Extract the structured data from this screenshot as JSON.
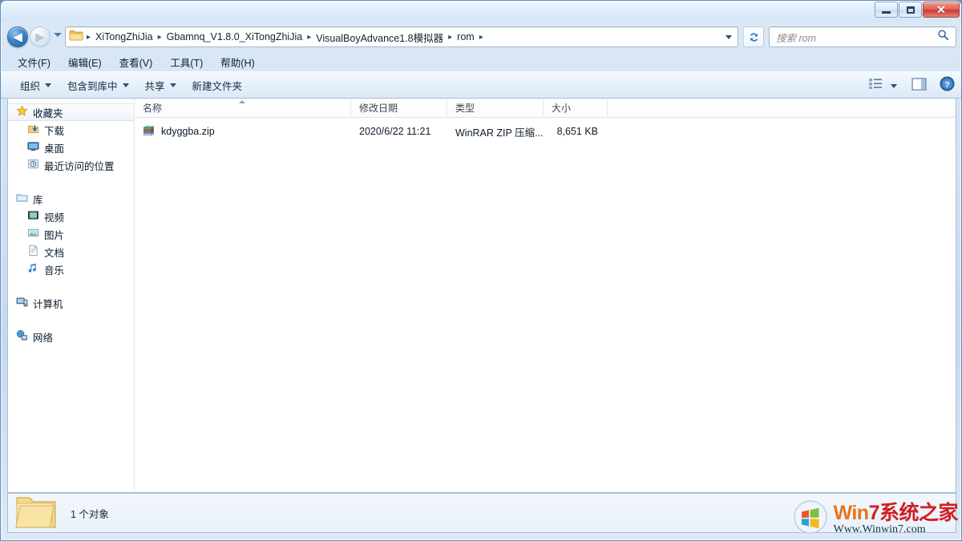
{
  "window": {
    "title": "",
    "buttons": {
      "minimize": "minimize",
      "maximize": "maximize",
      "close": "✕"
    }
  },
  "navigation": {
    "back_label": "◀",
    "forward_label": "▶",
    "history_dropdown": "history-dropdown",
    "refresh_label": "refresh"
  },
  "address": {
    "folder_icon": "folder-icon",
    "crumbs": [
      "XiTongZhiJia",
      "Gbamnq_V1.8.0_XiTongZhiJia",
      "VisualBoyAdvance1.8模拟器",
      "rom"
    ],
    "separator": "▸",
    "dropdown": "address-dropdown"
  },
  "search": {
    "placeholder": "搜索 rom",
    "icon": "search-icon"
  },
  "menubar": {
    "items": [
      {
        "label": "文件(F)"
      },
      {
        "label": "编辑(E)"
      },
      {
        "label": "查看(V)"
      },
      {
        "label": "工具(T)"
      },
      {
        "label": "帮助(H)"
      }
    ]
  },
  "commandbar": {
    "items": [
      {
        "label": "组织",
        "has_caret": true
      },
      {
        "label": "包含到库中",
        "has_caret": true
      },
      {
        "label": "共享",
        "has_caret": true
      },
      {
        "label": "新建文件夹",
        "has_caret": false
      }
    ],
    "right_icons": [
      {
        "name": "view-layout-icon"
      },
      {
        "name": "view-dropdown-caret"
      },
      {
        "name": "preview-pane-icon"
      },
      {
        "name": "help-icon"
      }
    ]
  },
  "navpane": {
    "groups": [
      {
        "header": {
          "label": "收藏夹",
          "icon": "star-icon",
          "selected": true
        },
        "items": [
          {
            "label": "下载",
            "icon": "download-icon"
          },
          {
            "label": "桌面",
            "icon": "desktop-icon"
          },
          {
            "label": "最近访问的位置",
            "icon": "recent-places-icon"
          }
        ]
      },
      {
        "header": {
          "label": "库",
          "icon": "library-icon",
          "selected": false
        },
        "items": [
          {
            "label": "视频",
            "icon": "video-icon"
          },
          {
            "label": "图片",
            "icon": "pictures-icon"
          },
          {
            "label": "文档",
            "icon": "documents-icon"
          },
          {
            "label": "音乐",
            "icon": "music-icon"
          }
        ]
      },
      {
        "header": {
          "label": "计算机",
          "icon": "computer-icon",
          "selected": false
        },
        "items": []
      },
      {
        "header": {
          "label": "网络",
          "icon": "network-icon",
          "selected": false
        },
        "items": []
      }
    ]
  },
  "filelist": {
    "columns": [
      {
        "key": "name",
        "label": "名称",
        "sorted": "asc"
      },
      {
        "key": "date",
        "label": "修改日期",
        "sorted": ""
      },
      {
        "key": "type",
        "label": "类型",
        "sorted": ""
      },
      {
        "key": "size",
        "label": "大小",
        "sorted": ""
      }
    ],
    "rows": [
      {
        "icon": "winrar-archive-icon",
        "name": "kdyggba.zip",
        "date": "2020/6/22 11:21",
        "type": "WinRAR ZIP 压缩...",
        "size": "8,651 KB"
      }
    ]
  },
  "statusbar": {
    "folder_icon": "folder-icon",
    "text": "1 个对象"
  },
  "watermark": {
    "logo": "windows-logo-icon",
    "title_win": "Win",
    "title_seven": "7",
    "title_cn": "系统之家",
    "url": "Www.Winwin7.com"
  },
  "colors": {
    "accent": "#2d6ba5",
    "close_button": "#cc3b2e",
    "watermark_orange": "#e8741c",
    "watermark_red": "#cf1f24",
    "frame": "#5f8bbd"
  }
}
